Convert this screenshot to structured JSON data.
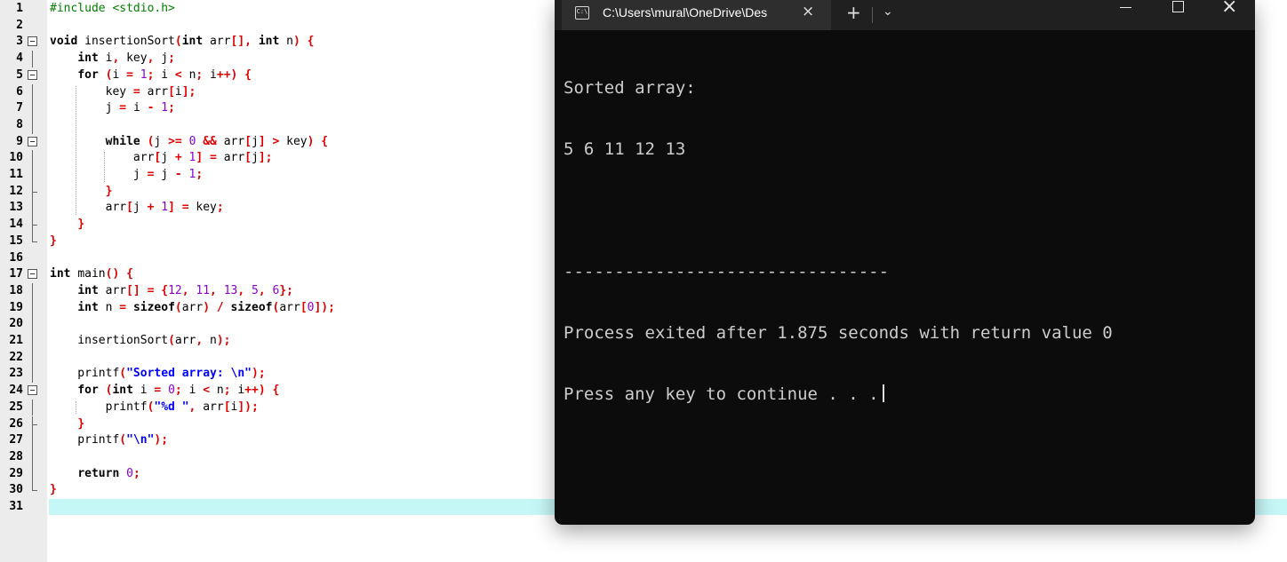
{
  "editor": {
    "lines": [
      {
        "n": "1",
        "tokens": [
          [
            "pp",
            "#include <stdio.h>"
          ]
        ]
      },
      {
        "n": "2",
        "tokens": []
      },
      {
        "n": "3",
        "tokens": [
          [
            "kw",
            "void "
          ],
          [
            "id",
            "insertionSort"
          ],
          [
            "pn",
            "("
          ],
          [
            "kw",
            "int "
          ],
          [
            "id",
            "arr"
          ],
          [
            "pn",
            "[], "
          ],
          [
            "kw",
            "int "
          ],
          [
            "id",
            "n"
          ],
          [
            "pn",
            ") {"
          ]
        ]
      },
      {
        "n": "4",
        "tokens": [
          [
            "id",
            "    "
          ],
          [
            "kw",
            "int "
          ],
          [
            "id",
            "i"
          ],
          [
            "pn",
            ", "
          ],
          [
            "id",
            "key"
          ],
          [
            "pn",
            ", "
          ],
          [
            "id",
            "j"
          ],
          [
            "pn",
            ";"
          ]
        ]
      },
      {
        "n": "5",
        "tokens": [
          [
            "id",
            "    "
          ],
          [
            "kw",
            "for "
          ],
          [
            "pn",
            "("
          ],
          [
            "id",
            "i "
          ],
          [
            "pn",
            "= "
          ],
          [
            "num",
            "1"
          ],
          [
            "pn",
            "; "
          ],
          [
            "id",
            "i "
          ],
          [
            "pn",
            "< "
          ],
          [
            "id",
            "n"
          ],
          [
            "pn",
            "; "
          ],
          [
            "id",
            "i"
          ],
          [
            "pn",
            "++) {"
          ]
        ]
      },
      {
        "n": "6",
        "tokens": [
          [
            "id",
            "        key "
          ],
          [
            "pn",
            "= "
          ],
          [
            "id",
            "arr"
          ],
          [
            "pn",
            "["
          ],
          [
            "id",
            "i"
          ],
          [
            "pn",
            "];"
          ]
        ]
      },
      {
        "n": "7",
        "tokens": [
          [
            "id",
            "        j "
          ],
          [
            "pn",
            "= "
          ],
          [
            "id",
            "i "
          ],
          [
            "pn",
            "- "
          ],
          [
            "num",
            "1"
          ],
          [
            "pn",
            ";"
          ]
        ]
      },
      {
        "n": "8",
        "tokens": []
      },
      {
        "n": "9",
        "tokens": [
          [
            "id",
            "        "
          ],
          [
            "kw",
            "while "
          ],
          [
            "pn",
            "("
          ],
          [
            "id",
            "j "
          ],
          [
            "pn",
            ">= "
          ],
          [
            "num",
            "0 "
          ],
          [
            "pn",
            "&& "
          ],
          [
            "id",
            "arr"
          ],
          [
            "pn",
            "["
          ],
          [
            "id",
            "j"
          ],
          [
            "pn",
            "] > "
          ],
          [
            "id",
            "key"
          ],
          [
            "pn",
            ") {"
          ]
        ]
      },
      {
        "n": "10",
        "tokens": [
          [
            "id",
            "            arr"
          ],
          [
            "pn",
            "["
          ],
          [
            "id",
            "j "
          ],
          [
            "pn",
            "+ "
          ],
          [
            "num",
            "1"
          ],
          [
            "pn",
            "] = "
          ],
          [
            "id",
            "arr"
          ],
          [
            "pn",
            "["
          ],
          [
            "id",
            "j"
          ],
          [
            "pn",
            "];"
          ]
        ]
      },
      {
        "n": "11",
        "tokens": [
          [
            "id",
            "            j "
          ],
          [
            "pn",
            "= "
          ],
          [
            "id",
            "j "
          ],
          [
            "pn",
            "- "
          ],
          [
            "num",
            "1"
          ],
          [
            "pn",
            ";"
          ]
        ]
      },
      {
        "n": "12",
        "tokens": [
          [
            "id",
            "        "
          ],
          [
            "pn",
            "}"
          ]
        ]
      },
      {
        "n": "13",
        "tokens": [
          [
            "id",
            "        arr"
          ],
          [
            "pn",
            "["
          ],
          [
            "id",
            "j "
          ],
          [
            "pn",
            "+ "
          ],
          [
            "num",
            "1"
          ],
          [
            "pn",
            "] = "
          ],
          [
            "id",
            "key"
          ],
          [
            "pn",
            ";"
          ]
        ]
      },
      {
        "n": "14",
        "tokens": [
          [
            "id",
            "    "
          ],
          [
            "pn",
            "}"
          ]
        ]
      },
      {
        "n": "15",
        "tokens": [
          [
            "pn",
            "}"
          ]
        ]
      },
      {
        "n": "16",
        "tokens": []
      },
      {
        "n": "17",
        "tokens": [
          [
            "kw",
            "int "
          ],
          [
            "id",
            "main"
          ],
          [
            "pn",
            "() {"
          ]
        ]
      },
      {
        "n": "18",
        "tokens": [
          [
            "id",
            "    "
          ],
          [
            "kw",
            "int "
          ],
          [
            "id",
            "arr"
          ],
          [
            "pn",
            "[] = {"
          ],
          [
            "num",
            "12"
          ],
          [
            "pn",
            ", "
          ],
          [
            "num",
            "11"
          ],
          [
            "pn",
            ", "
          ],
          [
            "num",
            "13"
          ],
          [
            "pn",
            ", "
          ],
          [
            "num",
            "5"
          ],
          [
            "pn",
            ", "
          ],
          [
            "num",
            "6"
          ],
          [
            "pn",
            "};"
          ]
        ]
      },
      {
        "n": "19",
        "tokens": [
          [
            "id",
            "    "
          ],
          [
            "kw",
            "int "
          ],
          [
            "id",
            "n "
          ],
          [
            "pn",
            "= "
          ],
          [
            "kw",
            "sizeof"
          ],
          [
            "pn",
            "("
          ],
          [
            "id",
            "arr"
          ],
          [
            "pn",
            ") / "
          ],
          [
            "kw",
            "sizeof"
          ],
          [
            "pn",
            "("
          ],
          [
            "id",
            "arr"
          ],
          [
            "pn",
            "["
          ],
          [
            "num",
            "0"
          ],
          [
            "pn",
            "]);"
          ]
        ]
      },
      {
        "n": "20",
        "tokens": []
      },
      {
        "n": "21",
        "tokens": [
          [
            "id",
            "    insertionSort"
          ],
          [
            "pn",
            "("
          ],
          [
            "id",
            "arr"
          ],
          [
            "pn",
            ", "
          ],
          [
            "id",
            "n"
          ],
          [
            "pn",
            ");"
          ]
        ]
      },
      {
        "n": "22",
        "tokens": []
      },
      {
        "n": "23",
        "tokens": [
          [
            "id",
            "    printf"
          ],
          [
            "pn",
            "("
          ],
          [
            "str",
            "\"Sorted array: \\n\""
          ],
          [
            "pn",
            ");"
          ]
        ]
      },
      {
        "n": "24",
        "tokens": [
          [
            "id",
            "    "
          ],
          [
            "kw",
            "for "
          ],
          [
            "pn",
            "("
          ],
          [
            "kw",
            "int "
          ],
          [
            "id",
            "i "
          ],
          [
            "pn",
            "= "
          ],
          [
            "num",
            "0"
          ],
          [
            "pn",
            "; "
          ],
          [
            "id",
            "i "
          ],
          [
            "pn",
            "< "
          ],
          [
            "id",
            "n"
          ],
          [
            "pn",
            "; "
          ],
          [
            "id",
            "i"
          ],
          [
            "pn",
            "++) {"
          ]
        ]
      },
      {
        "n": "25",
        "tokens": [
          [
            "id",
            "        printf"
          ],
          [
            "pn",
            "("
          ],
          [
            "str",
            "\"%d \""
          ],
          [
            "pn",
            ", "
          ],
          [
            "id",
            "arr"
          ],
          [
            "pn",
            "["
          ],
          [
            "id",
            "i"
          ],
          [
            "pn",
            "]);"
          ]
        ]
      },
      {
        "n": "26",
        "tokens": [
          [
            "id",
            "    "
          ],
          [
            "pn",
            "}"
          ]
        ]
      },
      {
        "n": "27",
        "tokens": [
          [
            "id",
            "    printf"
          ],
          [
            "pn",
            "("
          ],
          [
            "str",
            "\"\\n\""
          ],
          [
            "pn",
            ");"
          ]
        ]
      },
      {
        "n": "28",
        "tokens": []
      },
      {
        "n": "29",
        "tokens": [
          [
            "id",
            "    "
          ],
          [
            "kw",
            "return "
          ],
          [
            "num",
            "0"
          ],
          [
            "pn",
            ";"
          ]
        ]
      },
      {
        "n": "30",
        "tokens": [
          [
            "pn",
            "}"
          ]
        ]
      },
      {
        "n": "31",
        "tokens": []
      }
    ],
    "folds": {
      "3": "open",
      "5": "open",
      "9": "open",
      "17": "open",
      "24": "open",
      "12": "tee",
      "14": "tee",
      "26": "tee",
      "15": "end",
      "30": "end"
    }
  },
  "terminal": {
    "tab_title": "C:\\Users\\mural\\OneDrive\\Des",
    "tab_icon_text": "C:\\",
    "tab_close": "×",
    "new_tab": "+",
    "dropdown": "⌄",
    "close_window": "×",
    "output_lines": [
      "Sorted array:",
      "5 6 11 12 13",
      "",
      "--------------------------------",
      "Process exited after 1.875 seconds with return value 0",
      "Press any key to continue . . ."
    ]
  }
}
